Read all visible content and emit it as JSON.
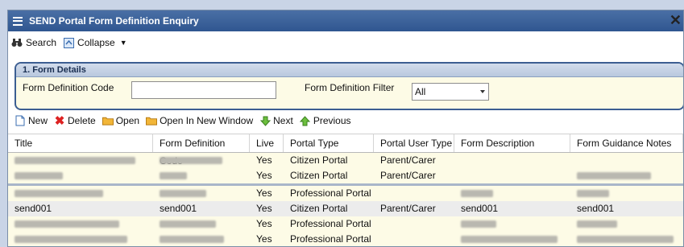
{
  "window": {
    "title": "SEND Portal Form Definition Enquiry",
    "close_glyph": "✕"
  },
  "toolbar": {
    "search_label": "Search",
    "collapse_label": "Collapse"
  },
  "section": {
    "title": "1. Form Details",
    "code_label": "Form Definition Code",
    "code_value": "",
    "filter_label": "Form Definition Filter",
    "filter_value": "All"
  },
  "actions": {
    "new_label": "New",
    "delete_label": "Delete",
    "open_label": "Open",
    "open_new_label": "Open In New Window",
    "next_label": "Next",
    "previous_label": "Previous"
  },
  "grid": {
    "headers": [
      "Title",
      "Form Definition Code",
      "Live",
      "Portal Type",
      "Portal User Type",
      "Form Description",
      "Form Guidance Notes"
    ],
    "rows": [
      {
        "title": "",
        "code": "",
        "live": "Yes",
        "portal": "Citizen Portal",
        "user": "Parent/Carer",
        "desc": "",
        "notes": ""
      },
      {
        "title": "",
        "code": "",
        "live": "Yes",
        "portal": "Citizen Portal",
        "user": "Parent/Carer",
        "desc": "",
        "notes": ""
      },
      {
        "title": "",
        "code": "",
        "live": "Yes",
        "portal": "Professional Portal",
        "user": "",
        "desc": "",
        "notes": ""
      },
      {
        "title": "send001",
        "code": "send001",
        "live": "Yes",
        "portal": "Citizen Portal",
        "user": "Parent/Carer",
        "desc": "send001",
        "notes": "send001"
      },
      {
        "title": "",
        "code": "",
        "live": "Yes",
        "portal": "Professional Portal",
        "user": "",
        "desc": "",
        "notes": ""
      },
      {
        "title": "",
        "code": "",
        "live": "Yes",
        "portal": "Professional Portal",
        "user": "",
        "desc": "",
        "notes": ""
      }
    ]
  },
  "colors": {
    "titlebar": "#2f5690",
    "section_border": "#3c5e92",
    "row_bg": "#fdfbe6"
  }
}
